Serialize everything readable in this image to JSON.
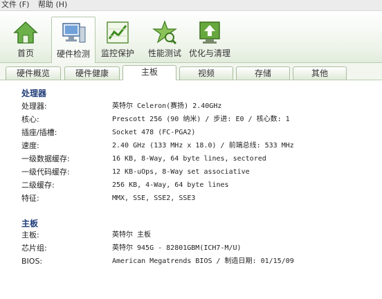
{
  "menu": [
    {
      "label": "文件 (F)"
    },
    {
      "label": "帮助 (H)"
    }
  ],
  "toolbar": [
    {
      "label": "首页",
      "icon": "home-icon"
    },
    {
      "label": "硬件检测",
      "icon": "computer-icon"
    },
    {
      "label": "监控保护",
      "icon": "monitor-chart-icon"
    },
    {
      "label": "性能测试",
      "icon": "star-search-icon"
    },
    {
      "label": "优化与清理",
      "icon": "upload-clean-icon"
    }
  ],
  "tabs": [
    {
      "label": "硬件概览"
    },
    {
      "label": "硬件健康"
    },
    {
      "label": "主板"
    },
    {
      "label": "视频"
    },
    {
      "label": "存储"
    },
    {
      "label": "其他"
    }
  ],
  "processor": {
    "title": "处理器",
    "rows": [
      {
        "key": "处理器:",
        "value": "英特尔 Celeron(赛扬) 2.40GHz"
      },
      {
        "key": "核心:",
        "value": "Prescott 256 (90 纳米) / 步进: E0 / 核心数: 1"
      },
      {
        "key": "插座/插槽:",
        "value": "Socket 478 (FC-PGA2)"
      },
      {
        "key": "速度:",
        "value": "2.40 GHz (133 MHz x 18.0) / 前端总线: 533 MHz"
      },
      {
        "key": "一级数据缓存:",
        "value": "16 KB, 8-Way, 64 byte lines, sectored"
      },
      {
        "key": "一级代码缓存:",
        "value": "12 KB-uOps, 8-Way set associative"
      },
      {
        "key": "二级缓存:",
        "value": "256 KB, 4-Way, 64 byte lines"
      },
      {
        "key": "特征:",
        "value": "MMX, SSE, SSE2, SSE3"
      }
    ]
  },
  "mainboard": {
    "title": "主板",
    "rows": [
      {
        "key": "主板:",
        "value": "英特尔 主板"
      },
      {
        "key": "芯片组:",
        "value": "英特尔 945G - 82801GBM(ICH7-M/U)"
      },
      {
        "key": "BIOS:",
        "value": "American Megatrends BIOS  /  制造日期: 01/15/09"
      }
    ]
  }
}
